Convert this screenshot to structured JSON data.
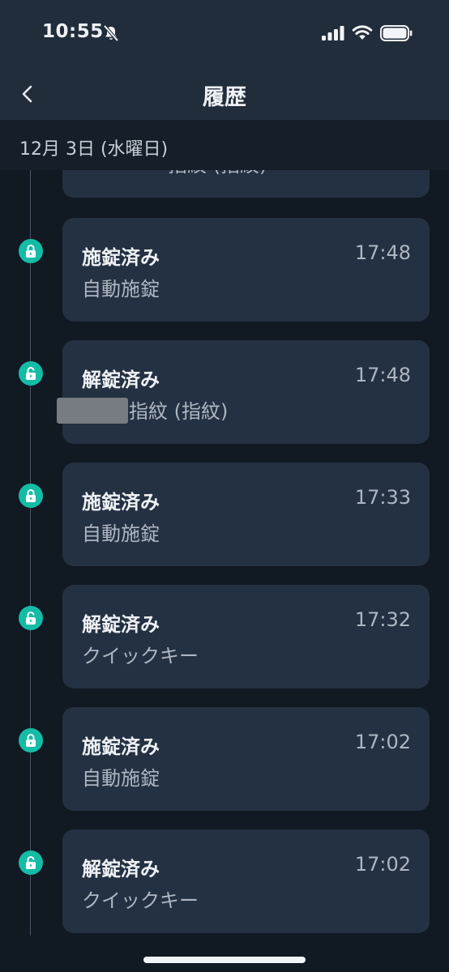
{
  "status_bar": {
    "time": "10:55"
  },
  "nav": {
    "title": "履歴"
  },
  "date_header": "12月 3日 (水曜日)",
  "top_partial_card": {
    "subtitle": "指紋 (指紋)"
  },
  "entries": [
    {
      "title": "施錠済み",
      "time": "17:48",
      "subtitle": "自動施錠",
      "icon": "lock-closed-icon"
    },
    {
      "title": "解錠済み",
      "time": "17:48",
      "subtitle": "指紋 (指紋)",
      "icon": "lock-open-icon"
    },
    {
      "title": "施錠済み",
      "time": "17:33",
      "subtitle": "自動施錠",
      "icon": "lock-closed-icon"
    },
    {
      "title": "解錠済み",
      "time": "17:32",
      "subtitle": "クイックキー",
      "icon": "lock-open-icon"
    },
    {
      "title": "施錠済み",
      "time": "17:02",
      "subtitle": "自動施錠",
      "icon": "lock-closed-icon"
    },
    {
      "title": "解錠済み",
      "time": "17:02",
      "subtitle": "クイックキー",
      "icon": "lock-open-icon"
    }
  ],
  "colors": {
    "accent": "#14bca6",
    "card": "#243142",
    "background": "#111923",
    "header": "#222d3b"
  }
}
